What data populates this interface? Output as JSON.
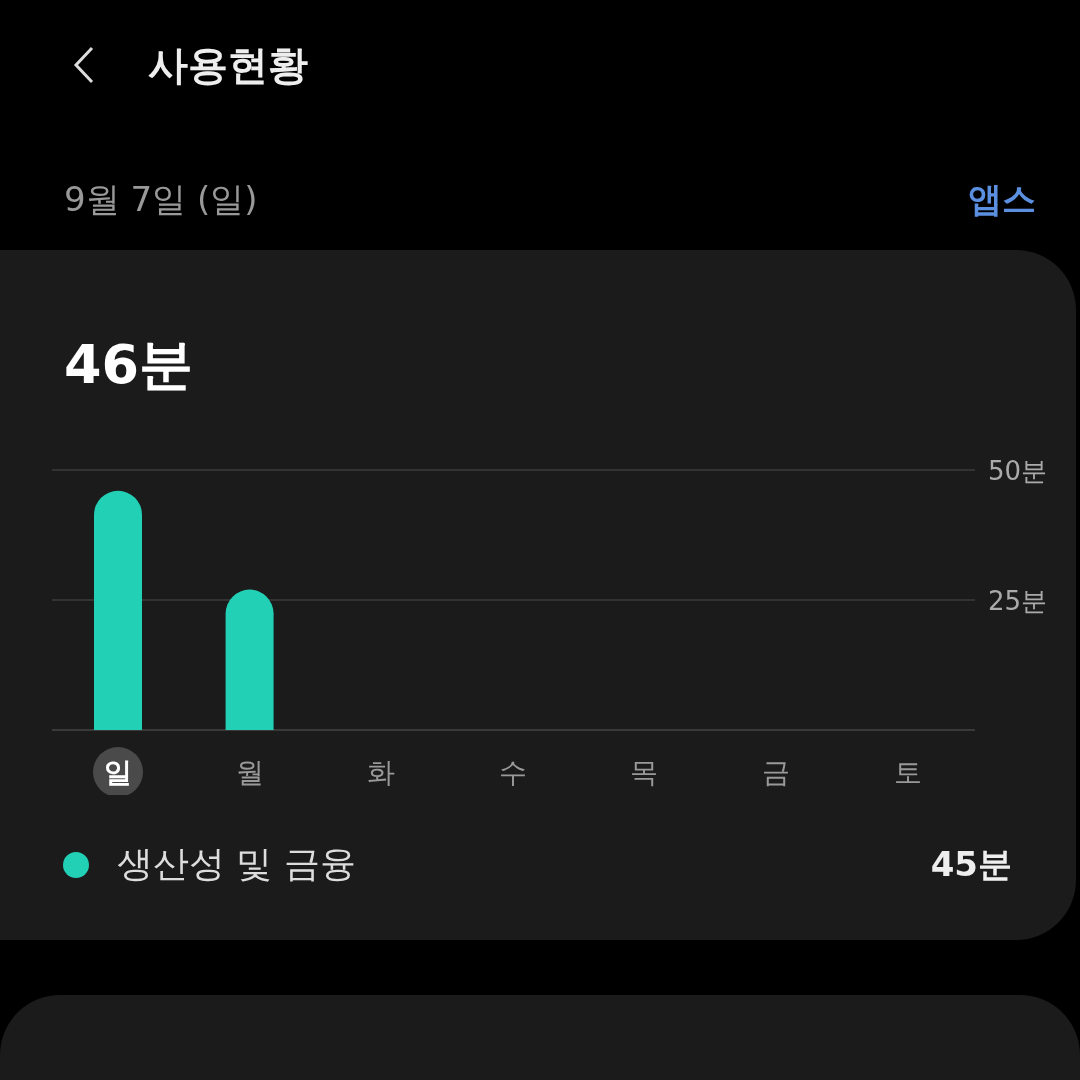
{
  "header": {
    "title": "사용현황",
    "date": "9월 7일 (일)",
    "apps_link": "앱스"
  },
  "summary": {
    "total": "46분",
    "chart_data": {
      "type": "bar",
      "categories": [
        "일",
        "월",
        "화",
        "수",
        "목",
        "금",
        "토"
      ],
      "series": [
        {
          "name": "생산성 및 금융",
          "color": "#22d0b5",
          "values": [
            46,
            27,
            null,
            null,
            null,
            null,
            null
          ]
        }
      ],
      "ylim": [
        0,
        50
      ],
      "yticks": [
        {
          "value": 25,
          "label": "25분"
        },
        {
          "value": 50,
          "label": "50분"
        }
      ]
    },
    "days": [
      {
        "selected": true
      },
      {
        "selected": false
      },
      {
        "selected": false
      },
      {
        "selected": false
      },
      {
        "selected": false
      },
      {
        "selected": false
      },
      {
        "selected": false
      }
    ],
    "legend": [
      {
        "value": "45분"
      }
    ]
  }
}
